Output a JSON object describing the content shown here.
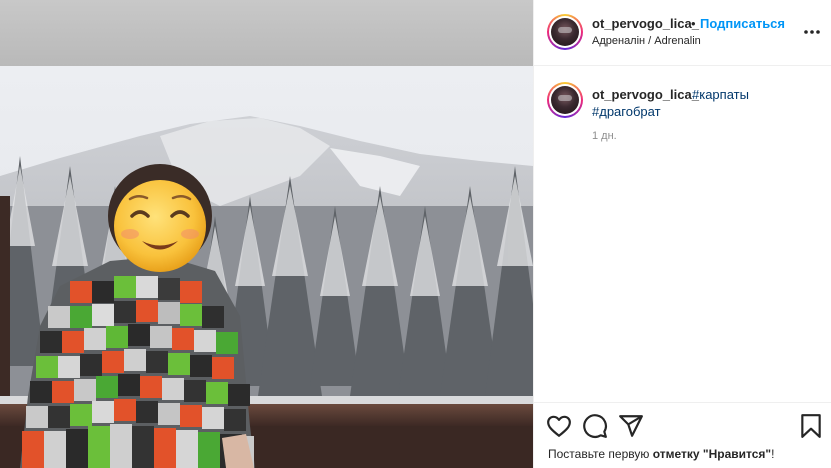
{
  "header": {
    "username": "ot_pervogo_lica_",
    "separator": "•",
    "follow_label": "Подписаться",
    "location": "Адреналін / Adrenalin"
  },
  "caption": {
    "username": "ot_pervogo_lica_",
    "hashtag_1": "#карпаты",
    "hashtag_2": "#драгобрат",
    "time": "1 дн."
  },
  "likes": {
    "prefix": "Поставьте первую ",
    "emphasis": "отметку \"Нравится\"",
    "suffix": "!"
  },
  "icons": {
    "more": "more-options-icon",
    "like": "heart-icon",
    "comment": "comment-icon",
    "share": "share-icon",
    "save": "bookmark-icon"
  },
  "colors": {
    "link_blue": "#0095f6",
    "hashtag": "#00376b",
    "muted": "#8e8e8e",
    "text": "#262626"
  }
}
